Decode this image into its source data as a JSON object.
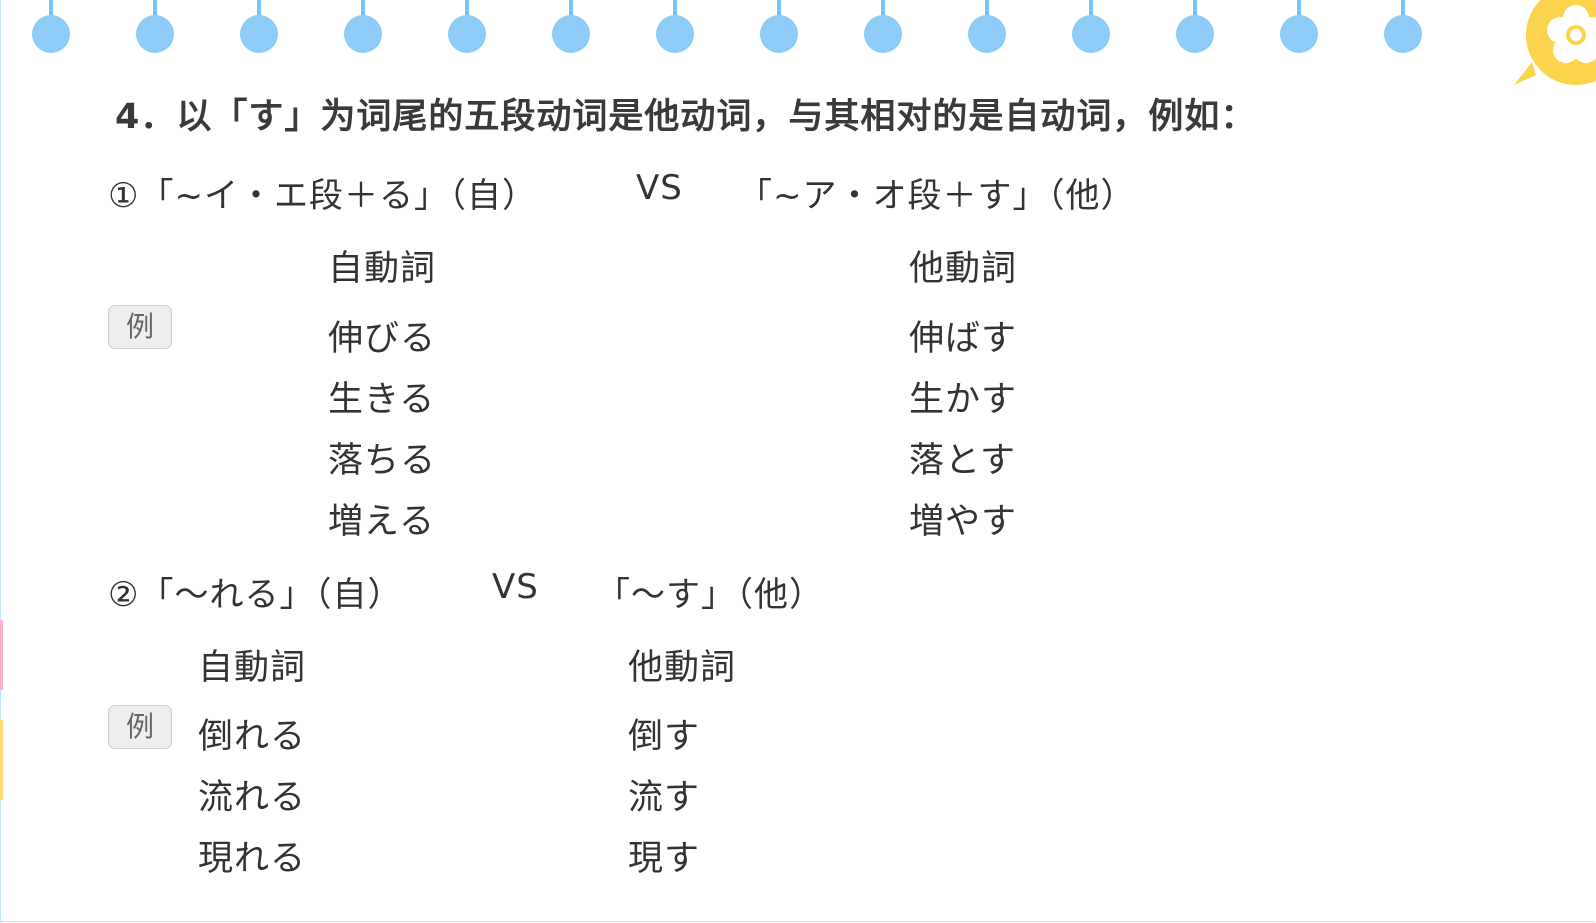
{
  "heading": "4．以「す」为词尾的五段动词是他动词，与其相对的是自动词，例如：",
  "example_tag": "例",
  "sections": [
    {
      "left": "①「~イ・エ段＋る」（自）",
      "vs": "VS",
      "right": "「~ア・オ段＋す」（他）",
      "col_intransitive": "自動詞",
      "col_transitive": "他動詞",
      "pairs": [
        {
          "intransitive": "伸びる",
          "transitive": "伸ばす"
        },
        {
          "intransitive": "生きる",
          "transitive": "生かす"
        },
        {
          "intransitive": "落ちる",
          "transitive": "落とす"
        },
        {
          "intransitive": "増える",
          "transitive": "増やす"
        }
      ]
    },
    {
      "left": "②「～れる」（自）",
      "vs": "VS",
      "right": "「～す」（他）",
      "col_intransitive": "自動詞",
      "col_transitive": "他動詞",
      "pairs": [
        {
          "intransitive": "倒れる",
          "transitive": "倒す"
        },
        {
          "intransitive": "流れる",
          "transitive": "流す"
        },
        {
          "intransitive": "現れる",
          "transitive": "現す"
        }
      ]
    }
  ],
  "colors": {
    "ring": "#8cccf7",
    "border": "#bfe4f7",
    "logo": "#fcd34d"
  },
  "icons": [
    "binder-ring-icon",
    "flower-badge-icon"
  ]
}
